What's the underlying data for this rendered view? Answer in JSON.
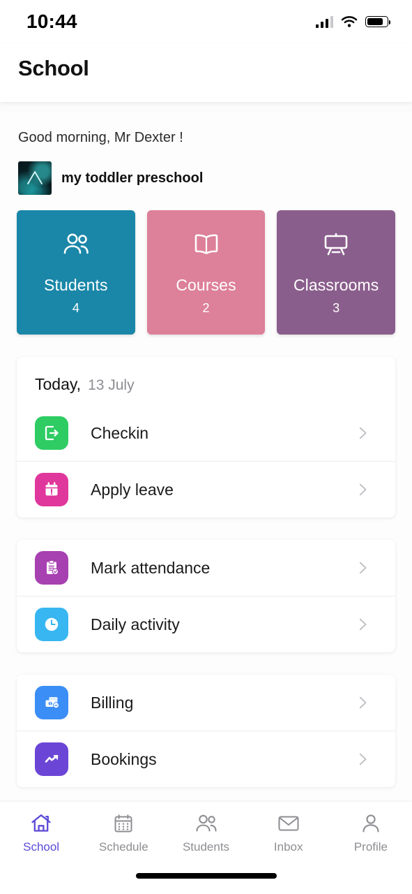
{
  "status_bar": {
    "time": "10:44",
    "cellular_icon": "cellular-signal-icon",
    "wifi_icon": "wifi-icon",
    "battery_icon": "battery-icon"
  },
  "header": {
    "title": "School"
  },
  "greeting": {
    "text": "Good morning, Mr Dexter !"
  },
  "school": {
    "name": "my toddler preschool",
    "logo_icon": "school-logo"
  },
  "tiles": [
    {
      "label": "Students",
      "count": "4",
      "color": "#1A87A8",
      "icon": "people-icon"
    },
    {
      "label": "Courses",
      "count": "2",
      "color": "#DD8099",
      "icon": "open-book-icon"
    },
    {
      "label": "Classrooms",
      "count": "3",
      "color": "#8A5E8C",
      "icon": "easel-board-icon"
    }
  ],
  "today_card": {
    "title_main": "Today,",
    "title_sub": "13 July",
    "rows": [
      {
        "label": "Checkin",
        "icon": "checkin-icon",
        "color": "#2ECC63"
      },
      {
        "label": "Apply leave",
        "icon": "calendar-alert-icon",
        "color": "#E0379C"
      }
    ]
  },
  "attendance_card": {
    "rows": [
      {
        "label": "Mark attendance",
        "icon": "clipboard-check-icon",
        "color": "#A740B0"
      },
      {
        "label": "Daily activity",
        "icon": "clock-icon",
        "color": "#38B6F1"
      }
    ]
  },
  "billing_card": {
    "rows": [
      {
        "label": "Billing",
        "icon": "money-bill-icon",
        "color": "#3B8EF5"
      },
      {
        "label": "Bookings",
        "icon": "trend-chart-icon",
        "color": "#6B46D6"
      }
    ]
  },
  "chevron_icon": "chevron-right-icon",
  "tabbar": {
    "active_color": "#5B4BD6",
    "inactive_color": "#8e8e93",
    "items": [
      {
        "label": "School",
        "icon": "home-icon",
        "active": true
      },
      {
        "label": "Schedule",
        "icon": "calendar-icon",
        "active": false
      },
      {
        "label": "Students",
        "icon": "people-icon",
        "active": false
      },
      {
        "label": "Inbox",
        "icon": "envelope-icon",
        "active": false
      },
      {
        "label": "Profile",
        "icon": "person-icon",
        "active": false
      }
    ]
  }
}
